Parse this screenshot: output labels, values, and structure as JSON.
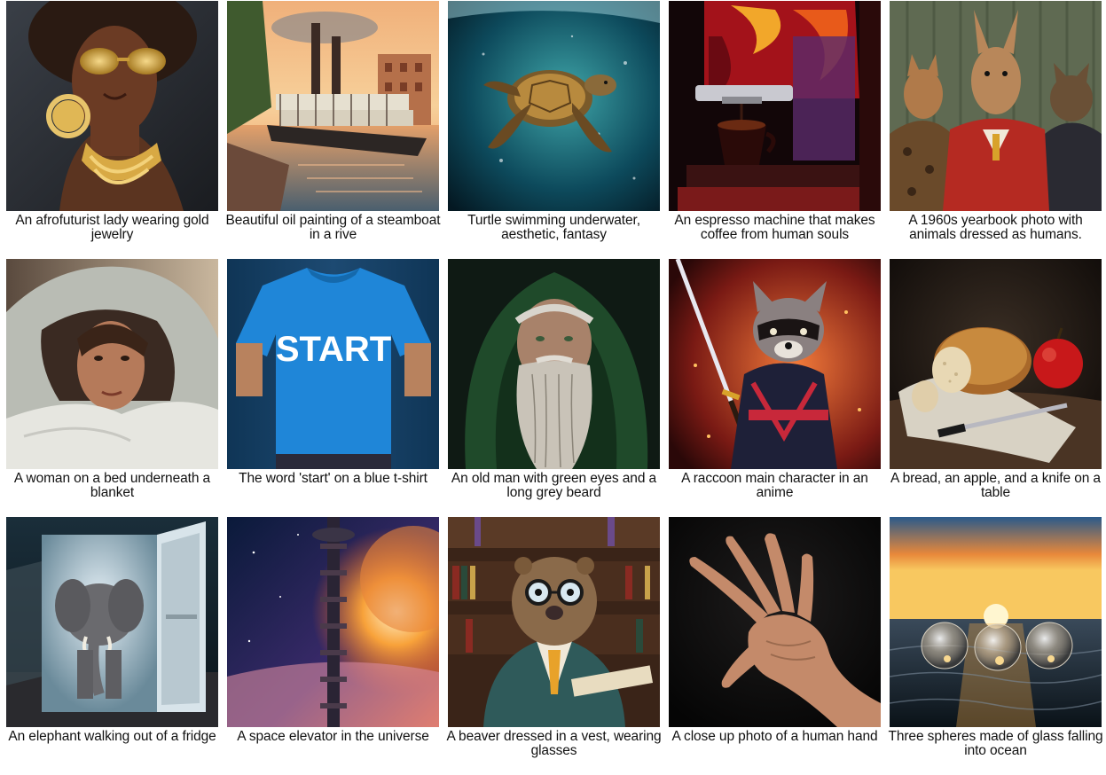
{
  "grid": {
    "items": [
      {
        "caption": "An afrofuturist lady wearing gold jewelry",
        "image": "afrofuturist-lady-image"
      },
      {
        "caption": "Beautiful oil painting of a steamboat in a rive",
        "image": "steamboat-painting-image"
      },
      {
        "caption": "Turtle swimming underwater, aesthetic, fantasy",
        "image": "turtle-underwater-image"
      },
      {
        "caption": "An espresso machine that makes coffee from human souls",
        "image": "espresso-machine-image"
      },
      {
        "caption": "A 1960s yearbook photo with animals dressed as humans.",
        "image": "animals-yearbook-image"
      },
      {
        "caption": "A woman on a bed underneath a blanket",
        "image": "woman-blanket-image"
      },
      {
        "caption": "The word 'start' on a blue t-shirt",
        "image": "blue-tshirt-image",
        "shirt_text": "START"
      },
      {
        "caption": "An old man with green eyes and a long grey beard",
        "image": "old-man-beard-image"
      },
      {
        "caption": "A raccoon main character in an anime",
        "image": "raccoon-anime-image"
      },
      {
        "caption": "A bread, an apple, and a knife on a table",
        "image": "bread-apple-knife-image"
      },
      {
        "caption": "An elephant walking out of a fridge",
        "image": "elephant-fridge-image"
      },
      {
        "caption": "A space elevator in the universe",
        "image": "space-elevator-image"
      },
      {
        "caption": "A beaver dressed in a vest, wearing glasses",
        "image": "beaver-vest-image"
      },
      {
        "caption": "A close up photo of a human hand",
        "image": "human-hand-image"
      },
      {
        "caption": "Three spheres made of glass falling into ocean",
        "image": "glass-spheres-ocean-image"
      }
    ]
  }
}
